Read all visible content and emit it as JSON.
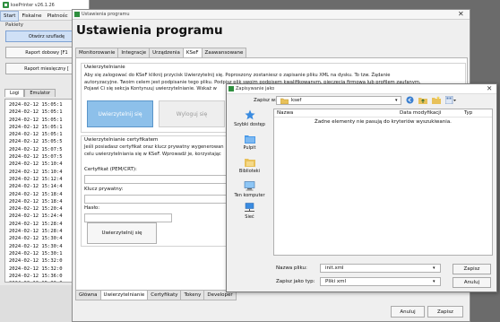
{
  "app": {
    "title": "ksePrinter v26.1.26",
    "menu": [
      "Start",
      "Fiskalne",
      "Płatnośc"
    ],
    "pakiety_label": "Pakiety",
    "buttons": [
      "Otwórz szufladę",
      "Raport dobowy [F1",
      "Raport miesięczny ["
    ],
    "log_tabs": [
      "Logi",
      "Emulator"
    ],
    "log_lines": [
      "2024-02-12 15:05:1",
      "2024-02-12 15:05:1",
      "2024-02-12 15:05:1",
      "2024-02-12 15:05:1",
      "2024-02-12 15:05:1",
      "2024-02-12 15:05:5",
      "2024-02-12 15:07:5",
      "2024-02-12 15:07:5",
      "2024-02-12 15:10:4",
      "2024-02-12 15:10:4",
      "2024-02-12 15:12:4",
      "2024-02-12 15:14:4",
      "2024-02-12 15:18:4",
      "2024-02-12 15:18:4",
      "2024-02-12 15:20:4",
      "2024-02-12 15:24:4",
      "2024-02-12 15:28:4",
      "2024-02-12 15:28:4",
      "2024-02-12 15:30:4",
      "2024-02-12 15:30:4",
      "2024-02-12 15:30:1",
      "2024-02-12 15:32:0",
      "2024-02-12 15:32:0",
      "2024-02-12 15:36:0",
      "2024-02-12 15:36:0"
    ]
  },
  "settings": {
    "window_title": "Ustawienia programu",
    "heading": "Ustawienia programu",
    "tabs": [
      "Monitorowanie",
      "Integracje",
      "Urządzenia",
      "KSeF",
      "Zaawansowane"
    ],
    "active_tab": "KSeF",
    "auth_group": {
      "legend": "Uwierzytelnianie",
      "desc1": "Aby się zalogować do KSeF kliknij przycisk Uwierzytelnij się. Poproszony zostaniesz o zapisanie pliku XML na dysku. To tzw. Żądanie",
      "desc2": "autoryzacyjne. Twoim celem jest podpisanie tego pliku. Podpisz plik swoim podpisem kwalifikowanym, pieczęcią firmową lub profilem zaufanym.",
      "desc3": "Pojawi Ci się sekcja Kontynuuj uwierzytelnianie. Wskaż w",
      "auth_button": "Uwierzytelnij się",
      "logout_button": "Wyloguj się"
    },
    "cert_group": {
      "legend": "Uwierzytelnianie certyfikatem",
      "desc1": "Jeśli posiadasz certyfikat oraz klucz prywatny wygenerowan",
      "desc2": "celu uwierzytelniania się w KSeF. Wprowadź je, korzystając",
      "cert_label": "Certyfikat (PEM/CRT):",
      "key_label": "Klucz prywatny:",
      "password_label": "Hasło:",
      "auth_button": "Uwierzytelnij się"
    },
    "bottom_tabs": [
      "Główna",
      "Uwierzytelnianie",
      "Certyfikaty",
      "Tokeny",
      "Developer"
    ],
    "active_bottom_tab": "Uwierzytelnianie",
    "cancel_button": "Anuluj",
    "save_button": "Zapisz"
  },
  "save_dialog": {
    "title": "Zapisywanie jako",
    "save_in_label": "Zapisz w:",
    "save_in_value": "ksef",
    "places": [
      "Szybki dostęp",
      "Pulpit",
      "Biblioteki",
      "Ten komputer",
      "Sieć"
    ],
    "columns": [
      "Nazwa",
      "Data modyfikacji",
      "Typ"
    ],
    "empty_message": "Żadne elementy nie pasują do kryteriów wyszukiwania.",
    "filename_label": "Nazwa pliku:",
    "filename_value": "init.xml",
    "filetype_label": "Zapisz jako typ:",
    "filetype_value": "Pliki xml",
    "save_button": "Zapisz",
    "cancel_button": "Anuluj"
  }
}
